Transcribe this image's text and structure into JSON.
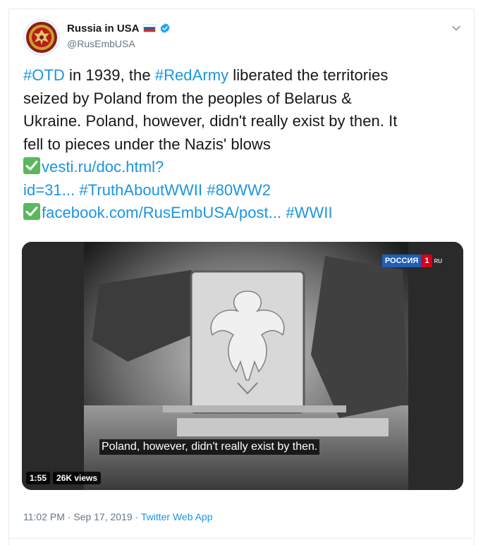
{
  "tweet": {
    "author": {
      "display_name": "Russia in USA",
      "handle": "@RusEmbUSA",
      "flag_icon": "russia-flag-icon",
      "verified_icon": "verified-badge-icon"
    },
    "text_lines": [
      [
        {
          "text": "#OTD",
          "kind": "hashtag"
        },
        {
          "text": " in 1939, the ",
          "kind": "text"
        },
        {
          "text": "#RedArmy",
          "kind": "hashtag"
        },
        {
          "text": " liberated the territories",
          "kind": "text"
        }
      ],
      [
        {
          "text": "seized by Poland from the peoples of Belarus &",
          "kind": "text"
        }
      ],
      [
        {
          "text": "Ukraine. Poland, however, didn't really exist by then. It",
          "kind": "text"
        }
      ],
      [
        {
          "text": "fell to pieces under the Nazis' blows",
          "kind": "text"
        }
      ],
      [
        {
          "text": "✅",
          "kind": "emoji"
        },
        {
          "text": "vesti.ru/doc.html?",
          "kind": "link"
        }
      ],
      [
        {
          "text": "id=31...",
          "kind": "link"
        },
        {
          "text": " ",
          "kind": "text"
        },
        {
          "text": "#TruthAboutWWII",
          "kind": "hashtag"
        },
        {
          "text": " ",
          "kind": "text"
        },
        {
          "text": "#80WW2",
          "kind": "hashtag"
        }
      ],
      [
        {
          "text": "✅",
          "kind": "emoji"
        },
        {
          "text": "facebook.com/RusEmbUSA/post...",
          "kind": "link"
        },
        {
          "text": " ",
          "kind": "text"
        },
        {
          "text": "#WWII",
          "kind": "hashtag"
        }
      ]
    ],
    "video": {
      "channel_name": "РОССИЯ",
      "channel_number": "1",
      "channel_suffix": "RU",
      "subtitle": "Poland, however, didn't really exist by then.",
      "duration": "1:55",
      "views": "26K views"
    },
    "timestamp": "11:02 PM · Sep 17, 2019",
    "separator": " · ",
    "source_app": "Twitter Web App",
    "colors": {
      "link": "#1b95e0",
      "text": "#14171a",
      "muted": "#657786",
      "verified": "#1da1f2",
      "check_emoji": "#5cb85c"
    }
  }
}
